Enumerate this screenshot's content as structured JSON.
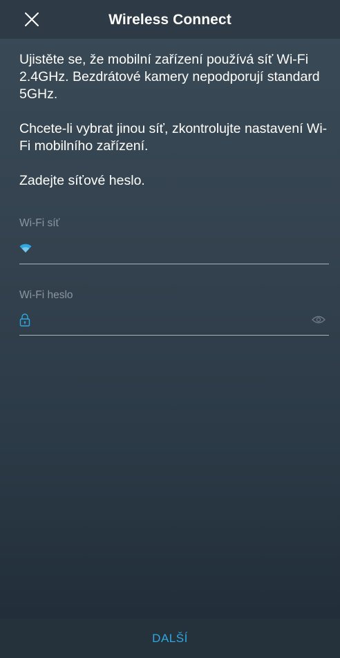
{
  "header": {
    "title": "Wireless Connect",
    "close_icon": "close-icon"
  },
  "instructions": {
    "paragraph_1": "Ujistěte se, že mobilní zařízení používá síť Wi-Fi 2.4GHz. Bezdrátové kamery nepodporují standard 5GHz.",
    "paragraph_2": "Chcete-li  vybrat jinou síť, zkontrolujte nastavení Wi-Fi mobilního zařízení.",
    "paragraph_3": "Zadejte síťové heslo."
  },
  "wifi_network": {
    "label": "Wi-Fi síť",
    "value": "",
    "icon": "wifi-icon"
  },
  "wifi_password": {
    "label": "Wi-Fi heslo",
    "value": "",
    "icon": "lock-icon",
    "toggle_icon": "eye-icon"
  },
  "footer": {
    "next_label": "DALŠÍ"
  },
  "colors": {
    "accent": "#2fa8e0",
    "background": "#34434f",
    "header": "#2e3b46",
    "footer": "#25313b",
    "muted_text": "#8a96a0"
  }
}
